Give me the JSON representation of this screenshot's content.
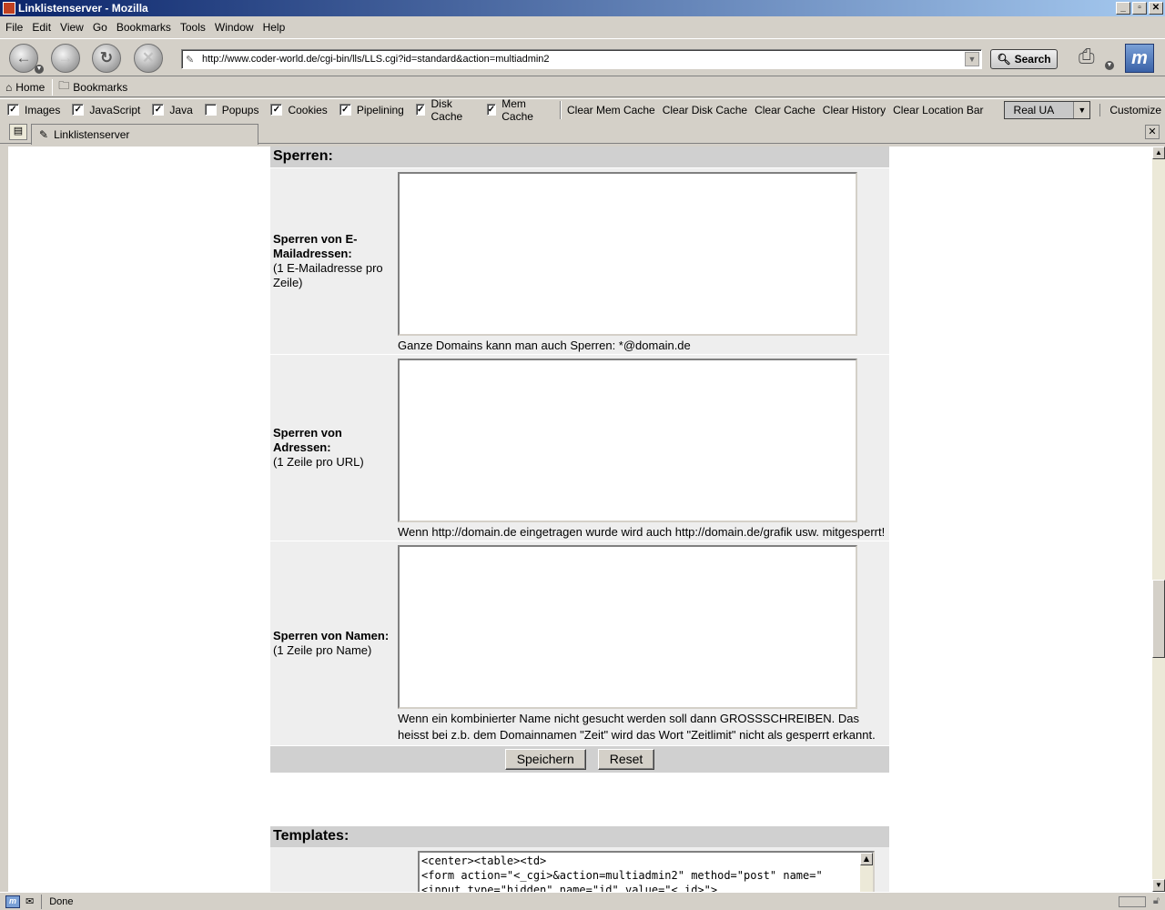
{
  "window": {
    "title": "Linklistenserver - Mozilla",
    "minimize": "_",
    "maximize": "▫",
    "close": "✕"
  },
  "menu": {
    "file": "File",
    "edit": "Edit",
    "view": "View",
    "go": "Go",
    "bookmarks": "Bookmarks",
    "tools": "Tools",
    "window": "Window",
    "help": "Help"
  },
  "nav": {
    "url": "http://www.coder-world.de/cgi-bin/lls/LLS.cgi?id=standard&action=multiadmin2",
    "search_label": "Search"
  },
  "personal": {
    "home": "Home",
    "bookmarks": "Bookmarks"
  },
  "prefbar": {
    "checks": [
      {
        "label": "Images",
        "checked": true
      },
      {
        "label": "JavaScript",
        "checked": true
      },
      {
        "label": "Java",
        "checked": true
      },
      {
        "label": "Popups",
        "checked": false
      },
      {
        "label": "Cookies",
        "checked": true
      },
      {
        "label": "Pipelining",
        "checked": true
      },
      {
        "label": "Disk Cache",
        "checked": true
      },
      {
        "label": "Mem Cache",
        "checked": true
      }
    ],
    "clear": [
      "Clear Mem Cache",
      "Clear Disk Cache",
      "Clear Cache",
      "Clear History",
      "Clear Location Bar"
    ],
    "ua_value": "Real UA",
    "customize": "Customize"
  },
  "tab": {
    "label": "Linklistenserver"
  },
  "sperren": {
    "heading": "Sperren:",
    "rows": [
      {
        "title": "Sperren von E-Mailadressen:",
        "note": "(1 E-Mailadresse pro Zeile)",
        "hint": "Ganze Domains kann man auch Sperren: *@domain.de"
      },
      {
        "title": "Sperren von Adressen:",
        "note": "(1 Zeile pro URL)",
        "hint": "Wenn http://domain.de eingetragen wurde wird auch http://domain.de/grafik usw. mitgesperrt!"
      },
      {
        "title": "Sperren von Namen:",
        "note": "(1 Zeile pro Name)",
        "hint": "Wenn ein kombinierter Name nicht gesucht werden soll dann GROSSSCHREIBEN. Das heisst bei z.b. dem Domainnamen \"Zeit\" wird das Wort \"Zeitlimit\" nicht als gesperrt erkannt."
      }
    ],
    "save_label": "Speichern",
    "reset_label": "Reset"
  },
  "templates": {
    "heading": "Templates:",
    "code_lines": [
      "<center><table><td>",
      "<form action=\"<_cgi>&action=multiadmin2\" method=\"post\" name=\"",
      "<input type=\"hidden\" name=\"id\" value=\"<_id>\">"
    ]
  },
  "status": {
    "text": "Done"
  }
}
